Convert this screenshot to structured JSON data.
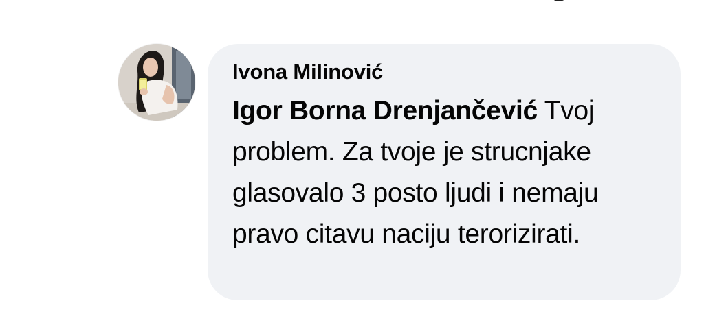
{
  "comment": {
    "author": "Ivona Milinović",
    "mention": "Igor Borna Drenjančević",
    "text": " Tvoj problem. Za tvoje je strucnjake glasovalo 3 posto ljudi i nemaju pravo citavu naciju terorizirati."
  },
  "colors": {
    "bubble_bg": "#f0f2f5",
    "text": "#050505",
    "action_text": "#65676b"
  },
  "icons": {
    "avatar": "profile-photo"
  }
}
